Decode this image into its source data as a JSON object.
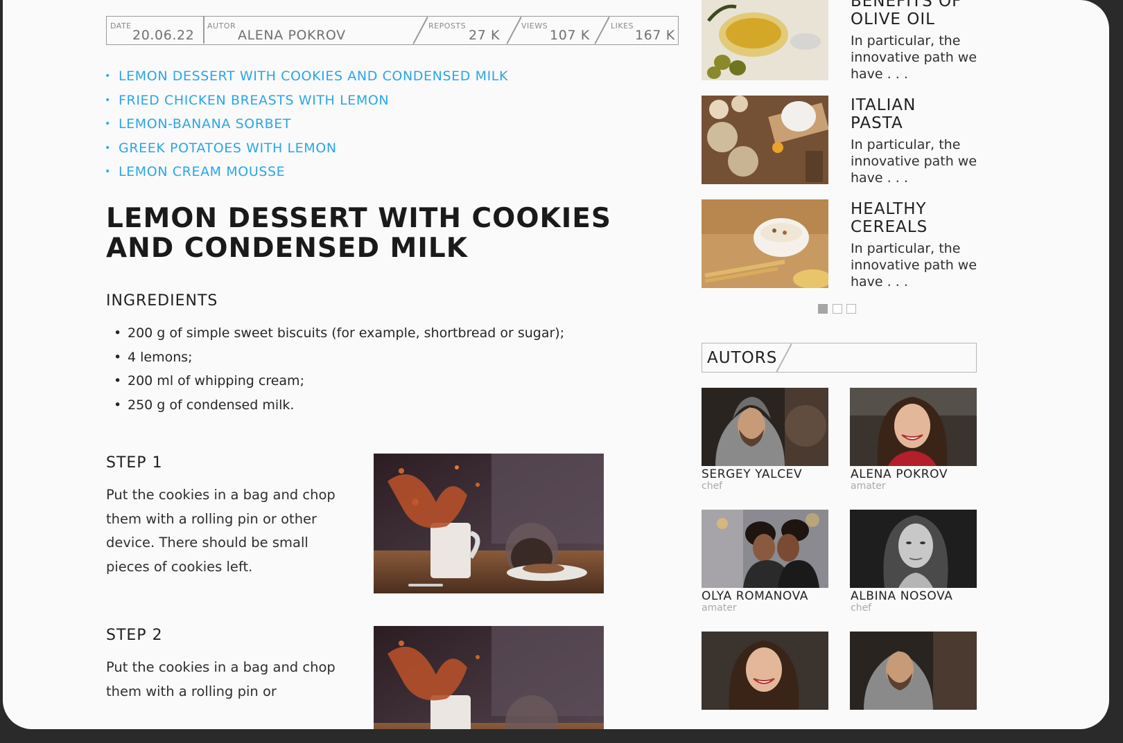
{
  "meta": {
    "date_label": "DATE",
    "date_value": "20.06.22",
    "author_label": "AUTOR",
    "author_value": "ALENA POKROV",
    "reposts_label": "REPOSTS",
    "reposts_value": "27 K",
    "views_label": "VIEWS",
    "views_value": "107 K",
    "likes_label": "LIKES",
    "likes_value": "167 K"
  },
  "related_links": [
    "LEMON DESSERT WITH COOKIES AND CONDENSED MILK",
    "FRIED CHICKEN BREASTS WITH LEMON",
    "LEMON-BANANA SORBET",
    "GREEK POTATOES WITH LEMON",
    "LEMON CREAM MOUSSE"
  ],
  "article": {
    "title_line1": "LEMON DESSERT WITH COOKIES",
    "title_line2": "AND CONDENSED MILK",
    "ingredients_heading": "INGREDIENTS",
    "ingredients": [
      "200 g of simple sweet biscuits (for example, shortbread or sugar);",
      "4 lemons;",
      "200 ml of whipping cream;",
      "250 g of condensed milk."
    ],
    "steps": [
      {
        "title": "STEP 1",
        "text": "Put the cookies in a bag and chop them with a rolling pin or other device. There should be small pieces of cookies left."
      },
      {
        "title": "STEP 2",
        "text": "Put the cookies in a bag and chop them with a rolling pin or"
      }
    ]
  },
  "sidebar": {
    "cards": [
      {
        "title_line1": "BENEFITS OF",
        "title_line2": "OLIVE OIL",
        "excerpt": "In particular, the innovative path we have . . ."
      },
      {
        "title_line1": "ITALIAN",
        "title_line2": "PASTA",
        "excerpt": "In particular, the innovative path we have . . ."
      },
      {
        "title_line1": "HEALTHY",
        "title_line2": "CEREALS",
        "excerpt": "In particular, the innovative path we have . . ."
      }
    ],
    "carousel": {
      "pages": 3,
      "active": 1
    },
    "autors_heading": "AUTORS",
    "authors": [
      {
        "name": "SERGEY YALCEV",
        "role": "chef"
      },
      {
        "name": "ALENA POKROV",
        "role": "amater"
      },
      {
        "name": "OLYA ROMANOVA",
        "role": "amater"
      },
      {
        "name": "ALBINA NOSOVA",
        "role": "chef"
      }
    ]
  },
  "colors": {
    "link": "#29a6e8",
    "text": "#1a1a1a",
    "border": "#9a9a9a",
    "muted": "#a9a9a9"
  }
}
